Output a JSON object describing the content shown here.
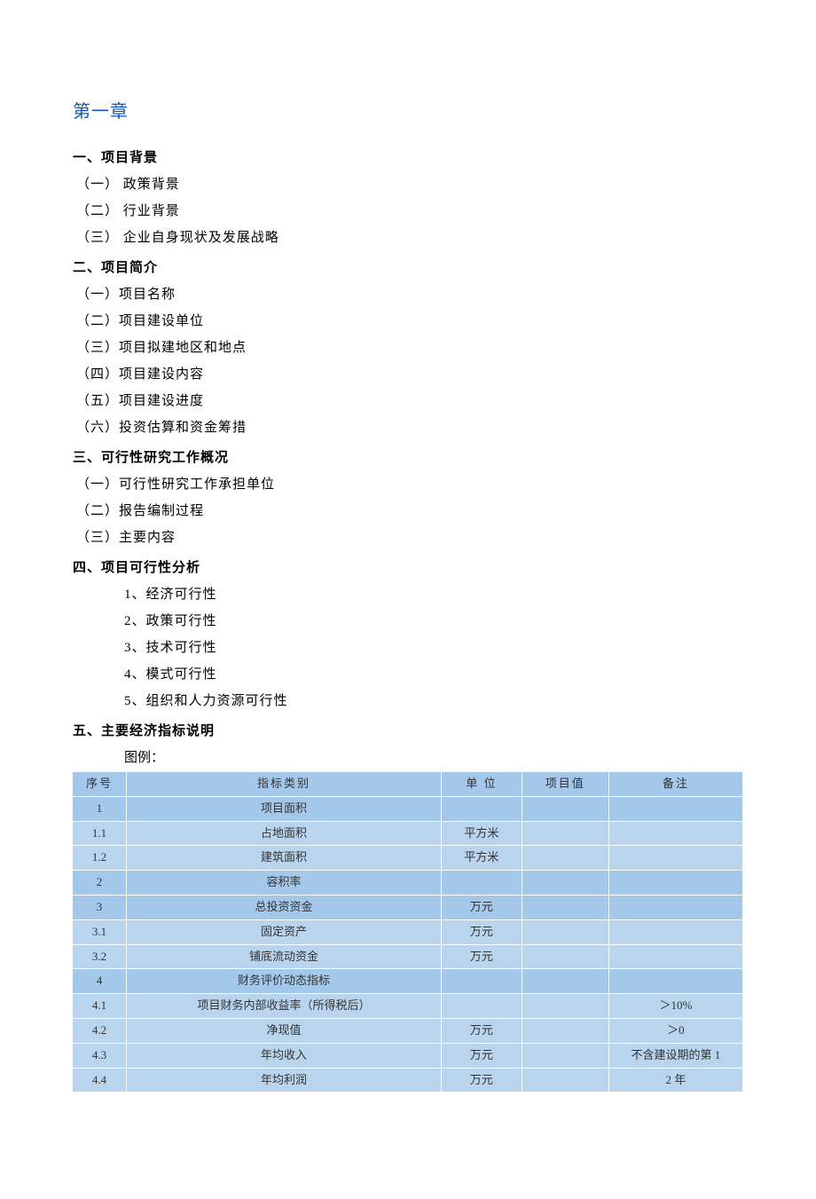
{
  "chapter_title": "第一章",
  "sections": {
    "s1": {
      "title": "一、项目背景",
      "items": [
        "（一） 政策背景",
        "（二） 行业背景",
        "（三） 企业自身现状及发展战略"
      ]
    },
    "s2": {
      "title": "二、项目简介",
      "items": [
        "（一）项目名称",
        "（二）项目建设单位",
        "（三）项目拟建地区和地点",
        "（四）项目建设内容",
        "（五）项目建设进度",
        "（六）投资估算和资金筹措"
      ]
    },
    "s3": {
      "title": "三、可行性研究工作概况",
      "items": [
        "（一）可行性研究工作承担单位",
        "（二）报告编制过程",
        "（三）主要内容"
      ]
    },
    "s4": {
      "title": "四、项目可行性分析",
      "items": [
        "1、经济可行性",
        "2、政策可行性",
        "3、技术可行性",
        "4、模式可行性",
        "5、组织和人力资源可行性"
      ]
    },
    "s5": {
      "title": "五、主要经济指标说明",
      "legend": "图例："
    }
  },
  "chart_data": {
    "type": "table",
    "headers": [
      "序号",
      "指标类别",
      "单 位",
      "项目值",
      "备注"
    ],
    "rows": [
      {
        "no": "1",
        "cat": "项目面积",
        "unit": "",
        "val": "",
        "note": "",
        "dark": true
      },
      {
        "no": "1.1",
        "cat": "占地面积",
        "unit": "平方米",
        "val": "",
        "note": "",
        "dark": false
      },
      {
        "no": "1.2",
        "cat": "建筑面积",
        "unit": "平方米",
        "val": "",
        "note": "",
        "dark": false
      },
      {
        "no": "2",
        "cat": "容积率",
        "unit": "",
        "val": "",
        "note": "",
        "dark": true
      },
      {
        "no": "3",
        "cat": "总投资资金",
        "unit": "万元",
        "val": "",
        "note": "",
        "dark": true
      },
      {
        "no": "3.1",
        "cat": "固定资产",
        "unit": "万元",
        "val": "",
        "note": "",
        "dark": false
      },
      {
        "no": "3.2",
        "cat": "铺底流动资金",
        "unit": "万元",
        "val": "",
        "note": "",
        "dark": false
      },
      {
        "no": "4",
        "cat": "财务评价动态指标",
        "unit": "",
        "val": "",
        "note": "",
        "dark": true
      },
      {
        "no": "4.1",
        "cat": "项目财务内部收益率（所得税后）",
        "unit": "",
        "val": "",
        "note": "＞10%",
        "dark": false
      },
      {
        "no": "4.2",
        "cat": "净现值",
        "unit": "万元",
        "val": "",
        "note": "＞0",
        "dark": false
      },
      {
        "no": "4.3",
        "cat": "年均收入",
        "unit": "万元",
        "val": "",
        "note": "不含建设期的第 1",
        "dark": false
      },
      {
        "no": "4.4",
        "cat": "年均利润",
        "unit": "万元",
        "val": "",
        "note": "2 年",
        "dark": false
      }
    ]
  }
}
